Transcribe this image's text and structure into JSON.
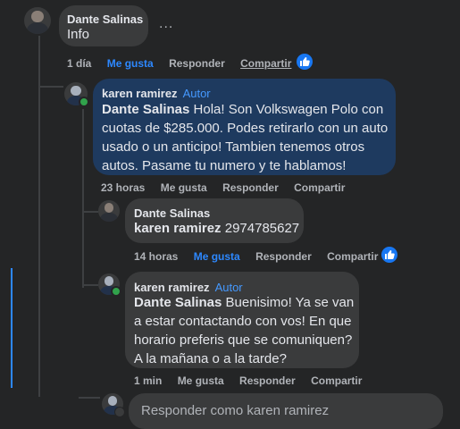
{
  "top_comment": {
    "author": "Dante Salinas",
    "text": "Info",
    "more": "...",
    "time": "1 día",
    "like_label": "Me gusta",
    "reply_label": "Responder",
    "share_label": "Compartir"
  },
  "reply1": {
    "author": "karen ramirez",
    "badge": "Autor",
    "mention": "Dante Salinas",
    "text": " Hola! Son Volkswagen Polo con cuotas de $285.000. Podes retirarlo con un auto usado o un anticipo! Tambien tenemos otros autos. Pasame tu numero y te hablamos!",
    "time": "23 horas",
    "like_label": "Me gusta",
    "reply_label": "Responder",
    "share_label": "Compartir"
  },
  "reply2": {
    "author": "Dante Salinas",
    "mention": "karen ramirez",
    "text": " 2974785627",
    "time": "14 horas",
    "like_label": "Me gusta",
    "reply_label": "Responder",
    "share_label": "Compartir"
  },
  "reply3": {
    "author": "karen ramirez",
    "badge": "Autor",
    "mention": "Dante Salinas",
    "text": " Buenisimo! Ya se van a estar contactando con vos! En que horario preferis que se comuniquen? A la mañana o a la tarde?",
    "time": "1 min",
    "like_label": "Me gusta",
    "reply_label": "Responder",
    "share_label": "Compartir"
  },
  "reply_input": {
    "placeholder": "Responder como karen ramirez"
  },
  "colors": {
    "background": "#242526",
    "bubble": "#3a3b3c",
    "author_bubble": "#1e3a5f",
    "accent": "#2d88ff",
    "badge": "#4599ff"
  }
}
